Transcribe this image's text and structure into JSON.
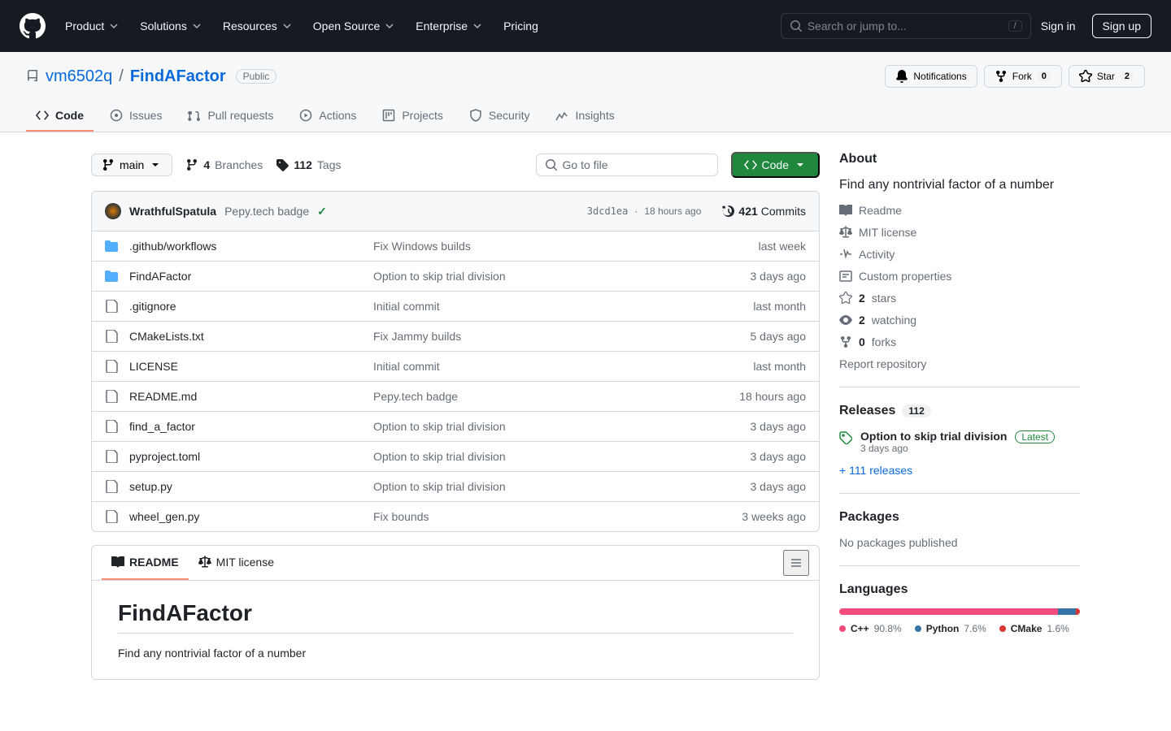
{
  "topnav": {
    "items": [
      "Product",
      "Solutions",
      "Resources",
      "Open Source",
      "Enterprise",
      "Pricing"
    ],
    "search_placeholder": "Search or jump to...",
    "sign_in": "Sign in",
    "sign_up": "Sign up"
  },
  "repo": {
    "owner": "vm6502q",
    "name": "FindAFactor",
    "public": "Public",
    "notifications": "Notifications",
    "fork": "Fork",
    "fork_count": "0",
    "star": "Star",
    "star_count": "2"
  },
  "tabs": [
    "Code",
    "Issues",
    "Pull requests",
    "Actions",
    "Projects",
    "Security",
    "Insights"
  ],
  "branch": {
    "name": "main",
    "branches_count": "4",
    "branches_label": "Branches",
    "tags_count": "112",
    "tags_label": "Tags"
  },
  "find_file_placeholder": "Go to file",
  "code_button": "Code",
  "commit": {
    "author": "WrathfulSpatula",
    "message": "Pepy.tech badge",
    "hash": "3dcd1ea",
    "time": "18 hours ago",
    "commits_count": "421",
    "commits_label": "Commits"
  },
  "files": [
    {
      "type": "dir",
      "name": ".github/workflows",
      "msg": "Fix Windows builds",
      "time": "last week"
    },
    {
      "type": "dir",
      "name": "FindAFactor",
      "msg": "Option to skip trial division",
      "time": "3 days ago"
    },
    {
      "type": "file",
      "name": ".gitignore",
      "msg": "Initial commit",
      "time": "last month"
    },
    {
      "type": "file",
      "name": "CMakeLists.txt",
      "msg": "Fix Jammy builds",
      "time": "5 days ago"
    },
    {
      "type": "file",
      "name": "LICENSE",
      "msg": "Initial commit",
      "time": "last month"
    },
    {
      "type": "file",
      "name": "README.md",
      "msg": "Pepy.tech badge",
      "time": "18 hours ago"
    },
    {
      "type": "file",
      "name": "find_a_factor",
      "msg": "Option to skip trial division",
      "time": "3 days ago"
    },
    {
      "type": "file",
      "name": "pyproject.toml",
      "msg": "Option to skip trial division",
      "time": "3 days ago"
    },
    {
      "type": "file",
      "name": "setup.py",
      "msg": "Option to skip trial division",
      "time": "3 days ago"
    },
    {
      "type": "file",
      "name": "wheel_gen.py",
      "msg": "Fix bounds",
      "time": "3 weeks ago"
    }
  ],
  "readme_tabs": {
    "readme": "README",
    "license": "MIT license"
  },
  "readme": {
    "title": "FindAFactor",
    "desc": "Find any nontrivial factor of a number"
  },
  "about": {
    "heading": "About",
    "desc": "Find any nontrivial factor of a number",
    "links": {
      "readme": "Readme",
      "license": "MIT license",
      "activity": "Activity",
      "custom": "Custom properties",
      "stars_n": "2",
      "stars_l": "stars",
      "watch_n": "2",
      "watch_l": "watching",
      "forks_n": "0",
      "forks_l": "forks",
      "report": "Report repository"
    }
  },
  "releases": {
    "heading": "Releases",
    "count": "112",
    "latest_title": "Option to skip trial division",
    "latest_badge": "Latest",
    "latest_date": "3 days ago",
    "more": "+ 111 releases"
  },
  "packages": {
    "heading": "Packages",
    "none": "No packages published"
  },
  "languages": {
    "heading": "Languages",
    "items": [
      {
        "name": "C++",
        "pct": "90.8%",
        "color": "#f34b7d"
      },
      {
        "name": "Python",
        "pct": "7.6%",
        "color": "#3572A5"
      },
      {
        "name": "CMake",
        "pct": "1.6%",
        "color": "#DA3434"
      }
    ]
  }
}
